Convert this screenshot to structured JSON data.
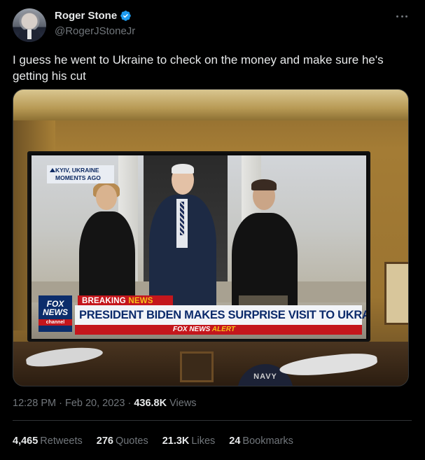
{
  "author": {
    "display_name": "Roger Stone",
    "handle": "@RogerJStoneJr",
    "verified": true
  },
  "tweet": {
    "text": "I guess he went to Ukraine to check on the money and make sure he's getting his cut"
  },
  "media": {
    "location_line1": "KYIV, UKRAINE",
    "location_line2": "MOMENTS AGO",
    "breaking_prefix": "BREAKING ",
    "breaking_accent": "NEWS",
    "headline": "PRESIDENT BIDEN MAKES SURPRISE VISIT TO UKRAINE",
    "alert_prefix": "FOX NEWS ",
    "alert_accent": "ALERT",
    "logo_text_1": "FOX",
    "logo_text_2": "NEWS",
    "logo_sub": "channel",
    "navy_text": "NAVY"
  },
  "meta": {
    "time": "12:28 PM",
    "sep1": " · ",
    "date": "Feb 20, 2023",
    "sep2": " · ",
    "views_count": "436.8K",
    "views_label": " Views"
  },
  "stats": {
    "retweets_count": "4,465",
    "retweets_label": "Retweets",
    "quotes_count": "276",
    "quotes_label": "Quotes",
    "likes_count": "21.3K",
    "likes_label": "Likes",
    "bookmarks_count": "24",
    "bookmarks_label": "Bookmarks"
  },
  "colors": {
    "background": "#000000",
    "text": "#e7e9ea",
    "secondary": "#71767b",
    "verified": "#1d9bf0"
  }
}
